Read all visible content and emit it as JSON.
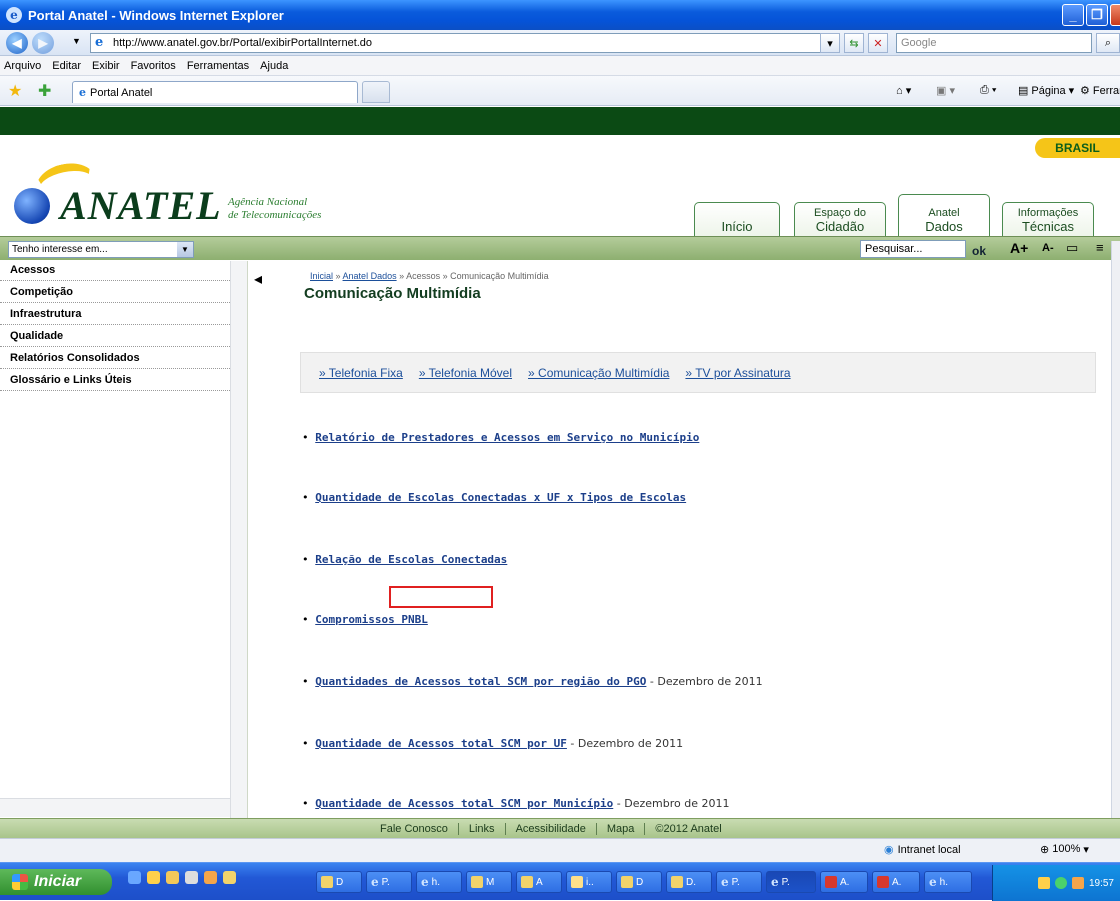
{
  "window": {
    "title": "Portal Anatel - Windows Internet Explorer",
    "min": "_",
    "max": "❐",
    "close": "✕"
  },
  "address": {
    "url": "http://www.anatel.gov.br/Portal/exibirPortalInternet.do",
    "search_placeholder": "Google"
  },
  "menu": [
    "Arquivo",
    "Editar",
    "Exibir",
    "Favoritos",
    "Ferramentas",
    "Ajuda"
  ],
  "favbar": {
    "tab_label": "Portal Anatel",
    "cmd_page": "Página",
    "cmd_tools": "Ferramentas"
  },
  "site": {
    "brasil": "BRASIL",
    "logo_word": "ANATEL",
    "agency_line1": "Agência Nacional",
    "agency_line2": "de Telecomunicações",
    "tabs": [
      {
        "line1": "Início",
        "line2": ""
      },
      {
        "line1": "Espaço do",
        "line2": "Cidadão"
      },
      {
        "line1": "Anatel",
        "line2": "Dados"
      },
      {
        "line1": "Informações",
        "line2": "Técnicas"
      }
    ],
    "interest": "Tenho interesse em...",
    "search_placeholder": "Pesquisar...",
    "ok": "ok",
    "font_plus": "A+",
    "font_minus": "A-"
  },
  "sidebar": [
    "Acessos",
    "Competição",
    "Infraestrutura",
    "Qualidade",
    "Relatórios Consolidados",
    "Glossário e Links Úteis"
  ],
  "breadcrumb": {
    "home": "Inicial",
    "section": "Anatel Dados",
    "rest": " » Acessos » Comunicação Multimídia"
  },
  "page_title": "Comunicação Multimídia",
  "subnav": [
    "» Telefonia Fixa",
    "» Telefonia Móvel",
    "» Comunicação Multimídia",
    "» TV por Assinatura"
  ],
  "links": [
    {
      "text": "Relatório de Prestadores e Acessos em Serviço no Município",
      "date": ""
    },
    {
      "text": "Quantidade de Escolas Conectadas x UF x Tipos de Escolas",
      "date": ""
    },
    {
      "text": "Relação de Escolas Conectadas",
      "date": ""
    },
    {
      "text": "Compromissos PNBL",
      "date": ""
    },
    {
      "text": "Quantidades de Acessos total SCM por região do PGO",
      "date": " - Dezembro de 2011"
    },
    {
      "text": "Quantidade de Acessos total SCM por UF",
      "date": " - Dezembro de 2011"
    },
    {
      "text": "Quantidade de Acessos total SCM por Município",
      "date": " - Dezembro de 2011"
    }
  ],
  "footer": [
    "Fale Conosco",
    "Links",
    "Acessibilidade",
    "Mapa",
    "©2012 Anatel"
  ],
  "status": {
    "zone": "Intranet local",
    "zoom": "100%"
  },
  "taskbar": {
    "start": "Iniciar",
    "items": [
      "D",
      "P.",
      "h.",
      "M",
      "A",
      "i..",
      "D",
      "D.",
      "P.",
      "P.",
      "A.",
      "A.",
      "h."
    ],
    "clock": "19:57"
  }
}
